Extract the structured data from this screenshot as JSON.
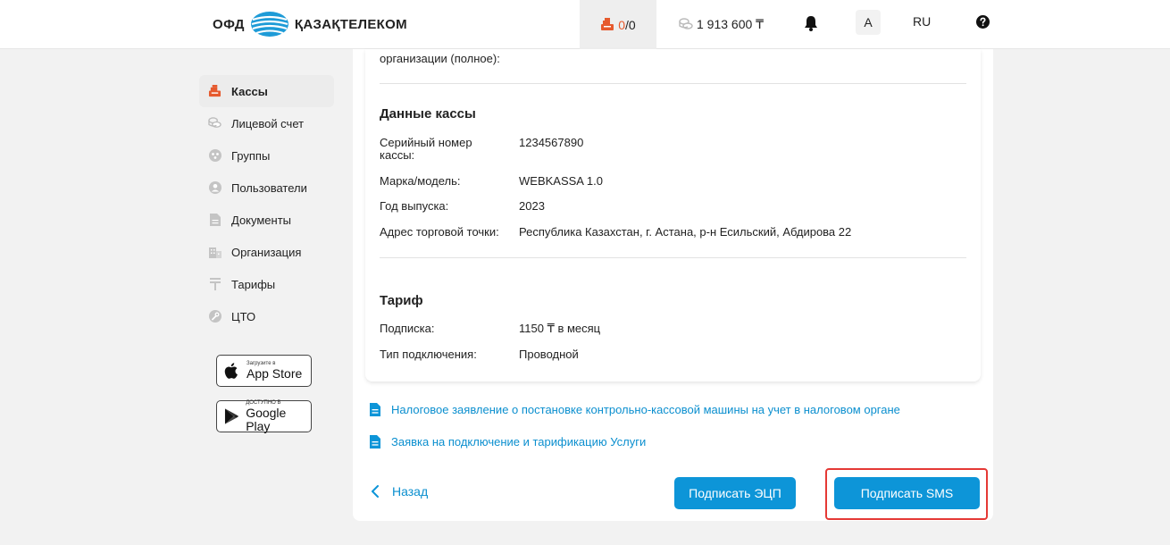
{
  "header": {
    "logo_left": "ОФД",
    "logo_right": "ҚАЗАҚТЕЛЕКОМ",
    "kassa_active": "0",
    "kassa_total": "/0",
    "balance": "1 913 600 ₸",
    "avatar_letter": "A",
    "lang": "RU"
  },
  "sidebar": {
    "items": [
      {
        "label": "Кассы",
        "icon": "cash-register-icon",
        "active": true
      },
      {
        "label": "Лицевой счет",
        "icon": "coins-icon"
      },
      {
        "label": "Группы",
        "icon": "groups-icon"
      },
      {
        "label": "Пользователи",
        "icon": "user-icon"
      },
      {
        "label": "Документы",
        "icon": "document-icon"
      },
      {
        "label": "Организация",
        "icon": "building-icon"
      },
      {
        "label": "Тарифы",
        "icon": "tenge-icon"
      },
      {
        "label": "ЦТО",
        "icon": "wrench-icon"
      }
    ],
    "appstore_small": "Загрузите в",
    "appstore_big": "App Store",
    "googleplay_small": "ДОСТУПНО В",
    "googleplay_big": "Google Play"
  },
  "org": {
    "name_label": "организации (полное):"
  },
  "kassa": {
    "title": "Данные кассы",
    "serial_label": "Серийный номер кассы:",
    "serial_value": "1234567890",
    "model_label": "Марка/модель:",
    "model_value": "WEBKASSA 1.0",
    "year_label": "Год выпуска:",
    "year_value": "2023",
    "address_label": "Адрес торговой точки:",
    "address_value": "Республика Казахстан, г. Астана, р-н Есильский, Абдирова 22"
  },
  "tariff": {
    "title": "Тариф",
    "subscription_label": "Подписка:",
    "subscription_value": "1150 ₸ в месяц",
    "connection_label": "Тип подключения:",
    "connection_value": "Проводной"
  },
  "documents": {
    "link1": "Налоговое заявление о постановке контрольно-кассовой машины на учет в налоговом органе",
    "link2": "Заявка на подключение и тарификацию Услуги"
  },
  "actions": {
    "back": "Назад",
    "sign_ecp": "Подписать ЭЦП",
    "sign_sms": "Подписать SMS"
  },
  "colors": {
    "accent": "#0d95d8",
    "link": "#0b8fcf",
    "active_icon": "#e65a2e",
    "highlight": "#e53935"
  }
}
